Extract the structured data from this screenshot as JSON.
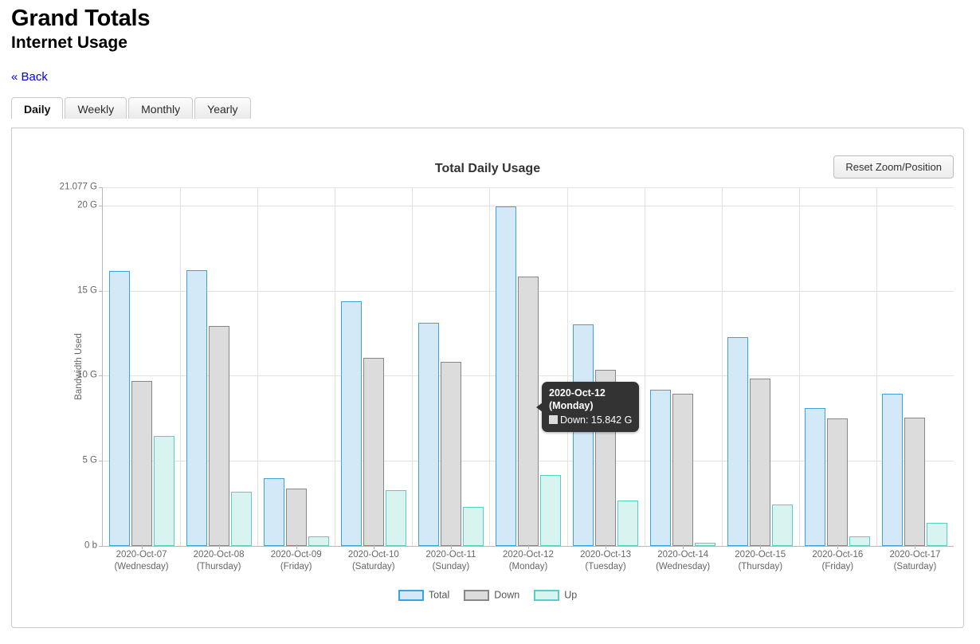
{
  "header": {
    "title": "Grand Totals",
    "subtitle": "Internet Usage",
    "back_label": "« Back"
  },
  "tabs": [
    {
      "label": "Daily",
      "active": true
    },
    {
      "label": "Weekly",
      "active": false
    },
    {
      "label": "Monthly",
      "active": false
    },
    {
      "label": "Yearly",
      "active": false
    }
  ],
  "toolbar": {
    "reset_label": "Reset Zoom/Position"
  },
  "tooltip": {
    "title": "2020-Oct-12\n(Monday)",
    "row_label": "Down: 15.842 G",
    "swatch_color": "#dcdcdc"
  },
  "colors": {
    "total": "#d3e9f8",
    "total_border": "#3ba4e0",
    "down": "#dcdcdc",
    "down_border": "#878787",
    "up": "#d7f4f0",
    "up_border": "#57cfc6",
    "grid": "#e2e2e2",
    "axis": "#b8b8b8",
    "link": "#0000ee"
  },
  "chart_data": {
    "type": "bar",
    "title": "Total Daily Usage",
    "xlabel": "",
    "ylabel": "Bandwidth Used",
    "ylim": [
      0,
      21.077
    ],
    "yunit": "G",
    "grid": true,
    "legend_position": "bottom",
    "ytick_values": [
      0,
      5,
      10,
      15,
      20,
      21.077
    ],
    "ytick_labels": [
      "0 b",
      "5 G",
      "10 G",
      "15 G",
      "20 G",
      "21.077 G"
    ],
    "categories": [
      "2020-Oct-07\n(Wednesday)",
      "2020-Oct-08\n(Thursday)",
      "2020-Oct-09\n(Friday)",
      "2020-Oct-10\n(Saturday)",
      "2020-Oct-11\n(Sunday)",
      "2020-Oct-12\n(Monday)",
      "2020-Oct-13\n(Tuesday)",
      "2020-Oct-14\n(Wednesday)",
      "2020-Oct-15\n(Thursday)",
      "2020-Oct-16\n(Friday)",
      "2020-Oct-17\n(Saturday)"
    ],
    "series": [
      {
        "name": "Total",
        "color": "#d3e9f8",
        "values": [
          16.15,
          16.2,
          3.98,
          14.4,
          13.1,
          19.95,
          13.0,
          9.2,
          12.25,
          8.1,
          8.95
        ]
      },
      {
        "name": "Down",
        "color": "#dcdcdc",
        "values": [
          9.7,
          12.95,
          3.35,
          11.05,
          10.8,
          15.842,
          10.35,
          8.95,
          9.85,
          7.5,
          7.55
        ]
      },
      {
        "name": "Up",
        "color": "#d7f4f0",
        "values": [
          6.45,
          3.2,
          0.55,
          3.3,
          2.3,
          4.15,
          2.65,
          0.2,
          2.45,
          0.55,
          1.35
        ]
      }
    ]
  }
}
